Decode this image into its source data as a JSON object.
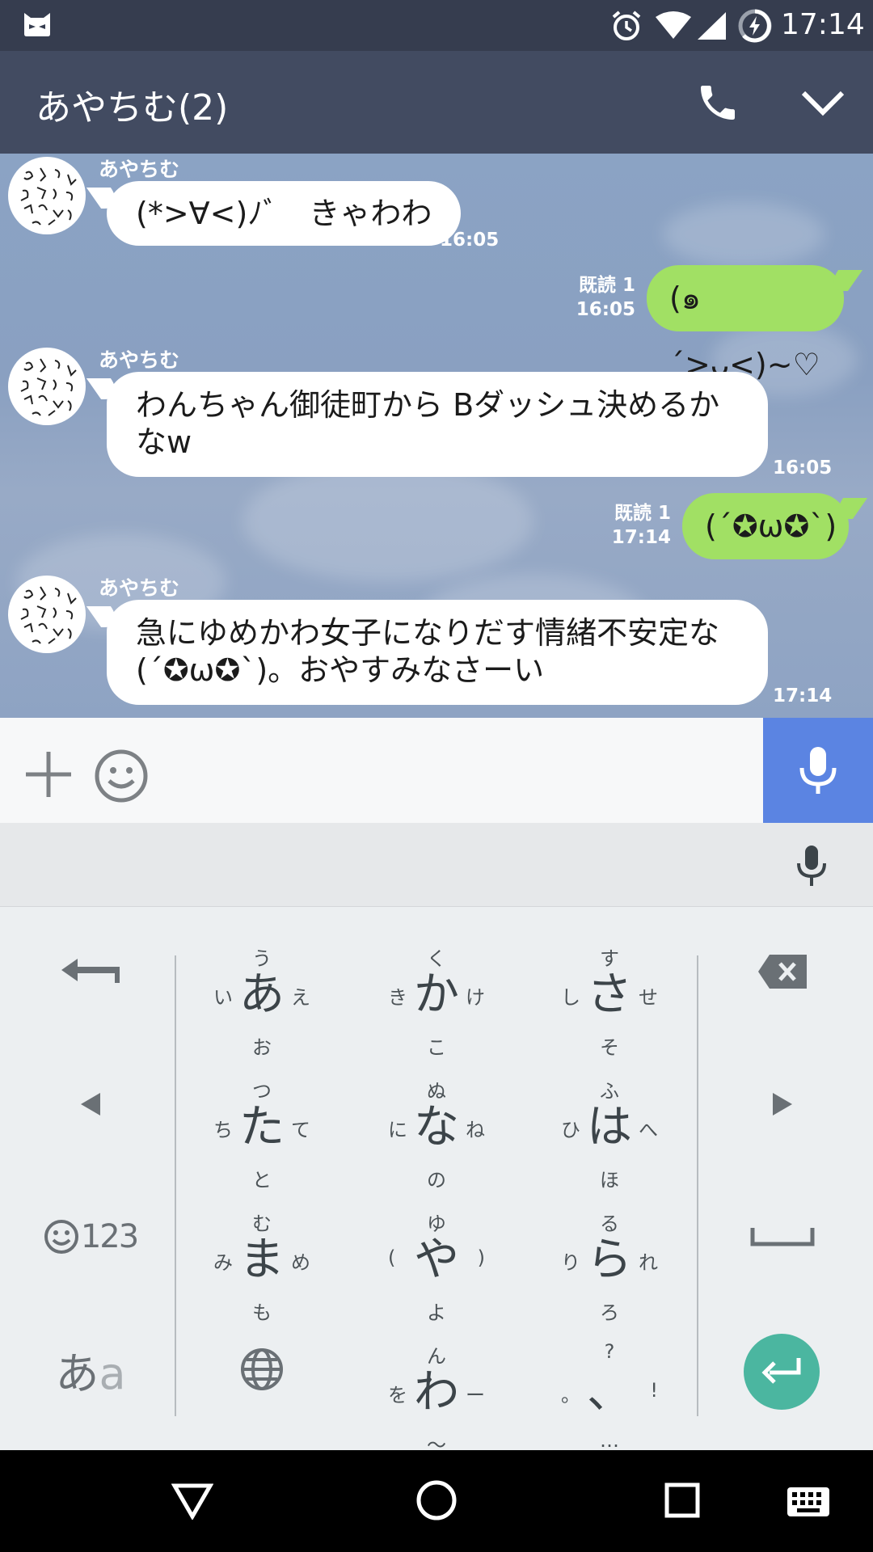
{
  "status_bar": {
    "time": "17:14"
  },
  "header": {
    "title": "あやちむ(2)"
  },
  "messages": [
    {
      "sender": "あやちむ",
      "text": "(*>∀<)ﾉﾞ　きゃわわ",
      "time": "16:05"
    },
    {
      "text": "(๑´>ᴗ<)~♡",
      "read": "既読 1",
      "time": "16:05"
    },
    {
      "sender": "あやちむ",
      "line1": "わんちゃん御徒町から Bダッシュ決めるか",
      "line2": "なw",
      "time": "16:05"
    },
    {
      "text": "(´✪ω✪`)",
      "read": "既読 1",
      "time": "17:14"
    },
    {
      "sender": "あやちむ",
      "line1": "急にゆめかわ女子になりだす情緒不安定な",
      "line2": "(´✪ω✪`)。おやすみなさーい",
      "time": "17:14"
    }
  ],
  "keyboard": {
    "keys": [
      {
        "main": "あ",
        "up": "う",
        "down": "お",
        "left": "い",
        "right": "え"
      },
      {
        "main": "か",
        "up": "く",
        "down": "こ",
        "left": "き",
        "right": "け"
      },
      {
        "main": "さ",
        "up": "す",
        "down": "そ",
        "left": "し",
        "right": "せ"
      },
      {
        "main": "た",
        "up": "つ",
        "down": "と",
        "left": "ち",
        "right": "て"
      },
      {
        "main": "な",
        "up": "ぬ",
        "down": "の",
        "left": "に",
        "right": "ね"
      },
      {
        "main": "は",
        "up": "ふ",
        "down": "ほ",
        "left": "ひ",
        "right": "へ"
      },
      {
        "main": "ま",
        "up": "む",
        "down": "も",
        "left": "み",
        "right": "め"
      },
      {
        "main": "や",
        "up": "ゆ",
        "down": "よ",
        "left": "(",
        "right": ")"
      },
      {
        "main": "ら",
        "up": "る",
        "down": "ろ",
        "left": "り",
        "right": "れ"
      },
      {
        "main": "わ",
        "up": "ん",
        "down": "〜",
        "left": "を",
        "right": "ー"
      },
      {
        "main": "、",
        "up": "?",
        "down": "…",
        "left": "。",
        "right": "!"
      }
    ],
    "emoji_label": "123",
    "kana_toggle_main": "あ",
    "kana_toggle_sub": "a"
  }
}
